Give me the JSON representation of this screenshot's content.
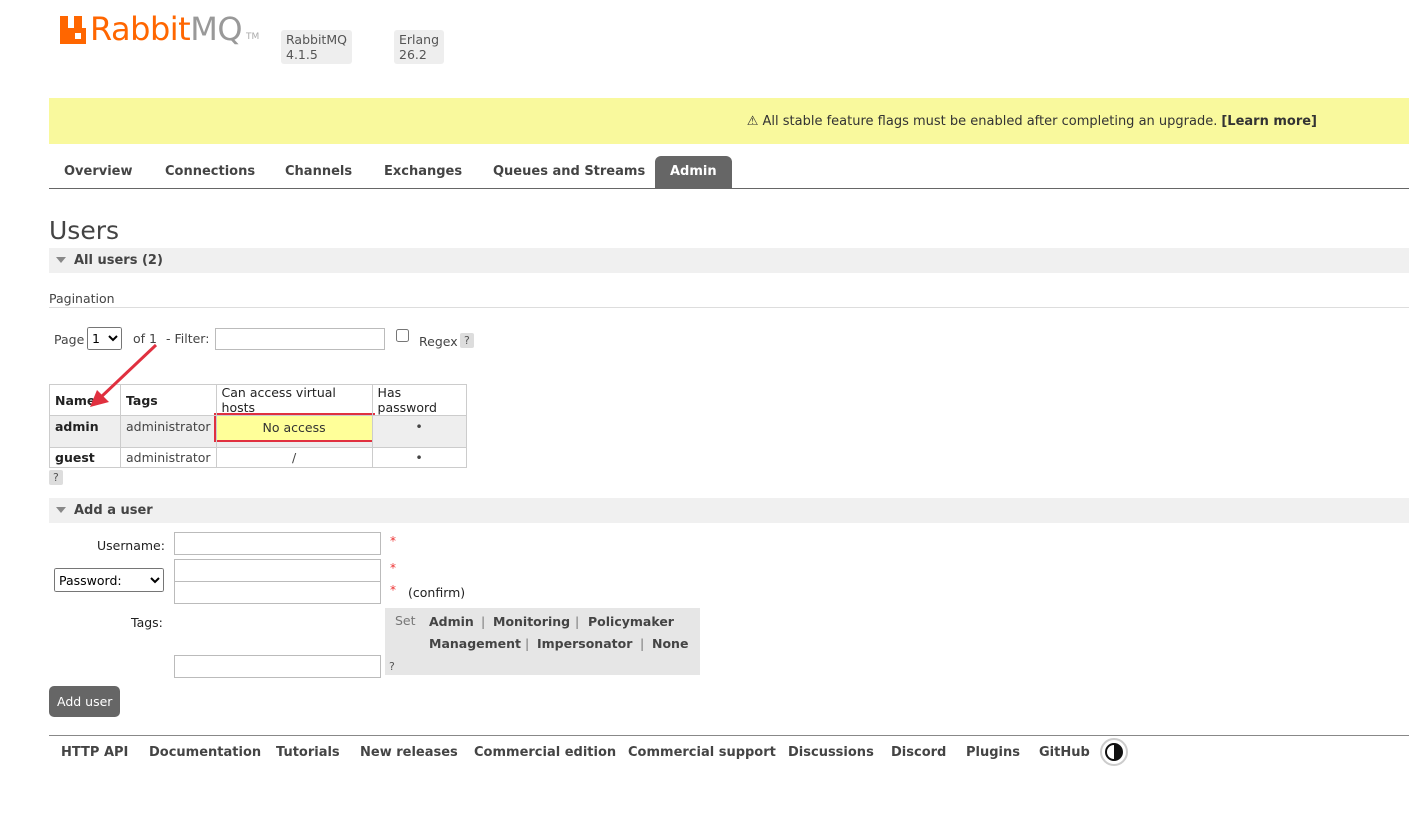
{
  "header": {
    "logo_rabbit": "Rabbit",
    "logo_mq": "MQ",
    "logo_tm": "TM",
    "version_badge": "RabbitMQ 4.1.5",
    "erlang_badge": "Erlang 26.2"
  },
  "banner": {
    "message": "⚠ All stable feature flags must be enabled after completing an upgrade.",
    "link": "[Learn more]",
    "color": "#f9f99d"
  },
  "tabs": [
    {
      "label": "Overview"
    },
    {
      "label": "Connections"
    },
    {
      "label": "Channels"
    },
    {
      "label": "Exchanges"
    },
    {
      "label": "Queues and Streams"
    },
    {
      "label": "Admin",
      "active": true
    }
  ],
  "page_title": "Users",
  "all_users": {
    "section_label": "All users (2)",
    "pagination_title": "Pagination",
    "page_label": "Page",
    "page_value": "1",
    "of_label": "of 1",
    "filter_label": "- Filter:",
    "filter_value": "",
    "regex_label": "Regex",
    "help": "?",
    "columns": [
      "Name",
      "Tags",
      "Can access virtual hosts",
      "Has password"
    ],
    "rows": [
      {
        "name": "admin",
        "tags": "administrator",
        "vhosts": "No access",
        "has_password": "•"
      },
      {
        "name": "guest",
        "tags": "administrator",
        "vhosts": "/",
        "has_password": "•"
      }
    ]
  },
  "add_user": {
    "section_label": "Add a user",
    "username_label": "Username:",
    "password_select": "Password:",
    "required_mark": "*",
    "confirm_label": "(confirm)",
    "tags_label": "Tags:",
    "set_label": "Set",
    "tag_options": [
      "Admin",
      "Monitoring",
      "Policymaker",
      "Management",
      "Impersonator",
      "None"
    ],
    "separator": "|",
    "help": "?",
    "submit_label": "Add user"
  },
  "footer": {
    "links": [
      "HTTP API",
      "Documentation",
      "Tutorials",
      "New releases",
      "Commercial edition",
      "Commercial support",
      "Discussions",
      "Discord",
      "Plugins",
      "GitHub"
    ]
  },
  "annotation": {
    "arrow_color": "#e0303f",
    "highlight_color": "#e0303f"
  }
}
